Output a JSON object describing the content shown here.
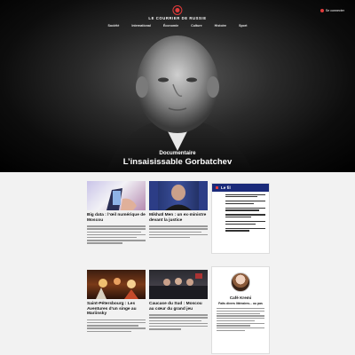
{
  "header": {
    "logo": "LE COURRIER DE RUSSIE",
    "login": "Se connecter",
    "nav": [
      "Société",
      "International",
      "Économie",
      "Culture",
      "Histoire",
      "Sport"
    ]
  },
  "hero": {
    "kicker": "Documentaire",
    "title": "L’insaisissable Gorbatchev"
  },
  "articles": [
    {
      "title": "Big data : l’œil numérique de Moscou",
      "author": ""
    },
    {
      "title": "Mikhaïl Men : un ex-ministre devant la justice",
      "author": ""
    },
    {
      "title": "Saint-Pétersbourg : Les Aventures d’un singe au Mariinsky",
      "author": ""
    },
    {
      "title": "Caucase du Sud : Moscou au cœur du grand jeu",
      "author": ""
    }
  ],
  "fil": {
    "title": "Le fil"
  },
  "cafe": {
    "title": "Café Kremi",
    "author": "",
    "subtitle": "Faits divers littéraires... ou pas"
  },
  "colors": {
    "accent": "#e23b3b",
    "fil_header": "#1a2a7a"
  }
}
